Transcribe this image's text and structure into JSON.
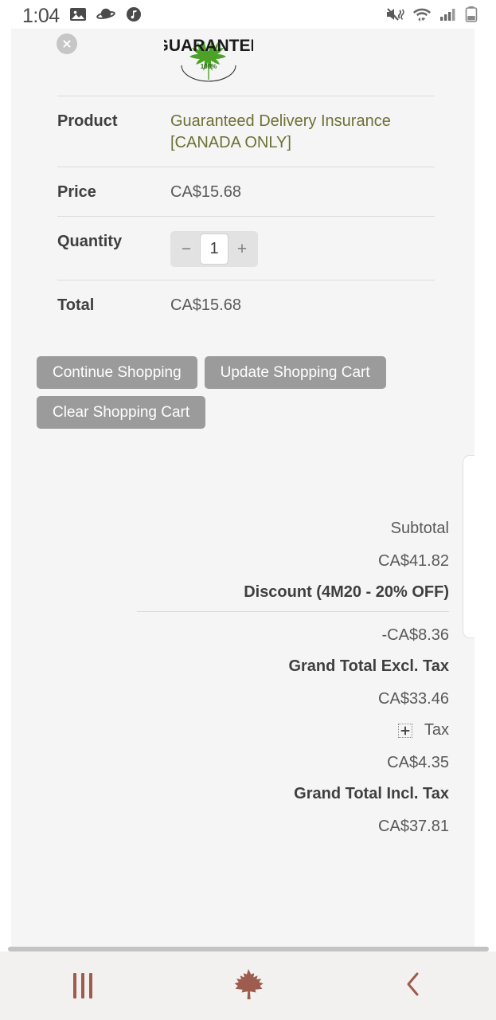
{
  "statusbar": {
    "time": "1:04",
    "left_icons": [
      "gallery-icon",
      "planet-icon",
      "music-note-icon"
    ],
    "right_icons": [
      "mute-vibrate-icon",
      "wifi-icon",
      "cellular-signal-icon",
      "battery-icon"
    ]
  },
  "cart": {
    "remove_icon": "close-circle-icon",
    "logo": {
      "name": "guarantee-logo",
      "top_text": "GUARANTEE",
      "badge_text": "100%"
    },
    "rows": [
      {
        "label": "Product",
        "value": "Guaranteed Delivery Insurance [CANADA ONLY]",
        "type": "link"
      },
      {
        "label": "Price",
        "value": "CA$15.68",
        "type": "text"
      },
      {
        "label": "Quantity",
        "value": "1",
        "type": "stepper"
      },
      {
        "label": "Total",
        "value": "CA$15.68",
        "type": "text"
      }
    ],
    "quantity": {
      "value": "1",
      "decrement_label": "−",
      "increment_label": "+"
    }
  },
  "buttons": {
    "continue_shopping": "Continue Shopping",
    "update_cart": "Update Shopping Cart",
    "clear_cart": "Clear Shopping Cart"
  },
  "totals": {
    "subtotal_label": "Subtotal",
    "subtotal_value": "CA$41.82",
    "discount_label": "Discount (4M20 - 20% OFF)",
    "discount_value": "-CA$8.36",
    "grand_total_excl_label": "Grand Total Excl. Tax",
    "grand_total_excl_value": "CA$33.46",
    "tax_label": "Tax",
    "tax_expander_icon": "plus-box-icon",
    "tax_value": "CA$4.35",
    "grand_total_incl_label": "Grand Total Incl. Tax",
    "grand_total_incl_value": "CA$37.81"
  },
  "navbar": {
    "recents_label": "recents-button",
    "home_label": "home-maple-leaf-button",
    "back_label": "back-button"
  },
  "colors": {
    "page_bg": "#f5f5f5",
    "button_gray": "#9b9b9b",
    "product_link": "#6f7035",
    "nav_accent": "#9e5c4e",
    "leaf_green": "#4ca226"
  }
}
